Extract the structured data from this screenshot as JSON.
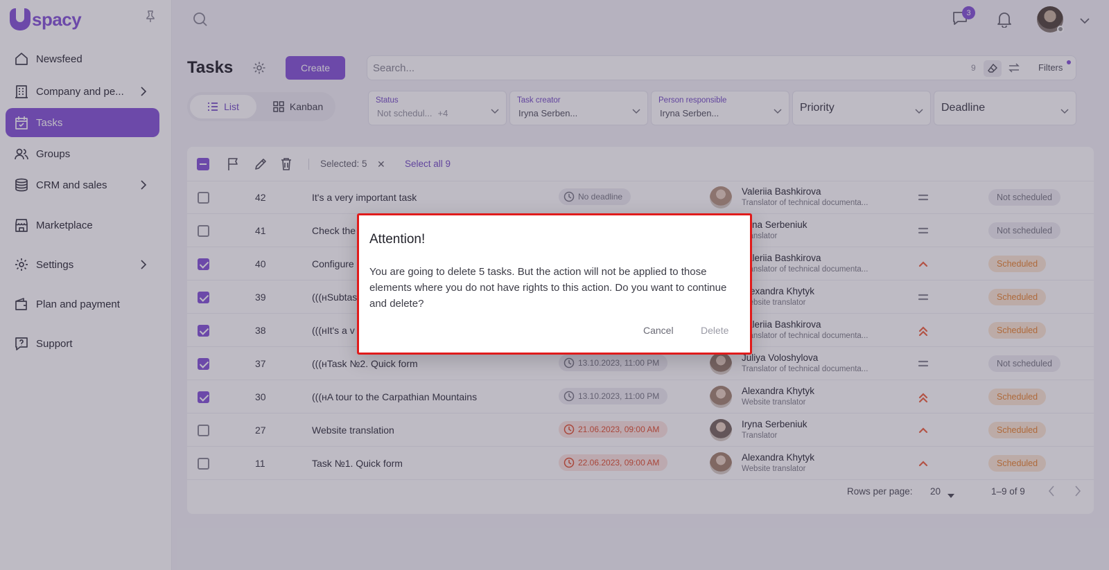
{
  "brand": {
    "name": "spacy",
    "color": "#8a5cd8"
  },
  "sidebar": {
    "items": [
      {
        "label": "Newsfeed",
        "icon": "home-icon",
        "has_children": false,
        "active": false
      },
      {
        "label": "Company and pe...",
        "icon": "building-icon",
        "has_children": true,
        "active": false
      },
      {
        "label": "Tasks",
        "icon": "calendar-check-icon",
        "has_children": false,
        "active": true
      },
      {
        "label": "Groups",
        "icon": "users-icon",
        "has_children": false,
        "active": false
      },
      {
        "label": "CRM and sales",
        "icon": "coins-icon",
        "has_children": true,
        "active": false
      },
      {
        "label": "Marketplace",
        "icon": "store-icon",
        "has_children": false,
        "active": false
      },
      {
        "label": "Settings",
        "icon": "gear-icon",
        "has_children": true,
        "active": false
      },
      {
        "label": "Plan and payment",
        "icon": "wallet-icon",
        "has_children": false,
        "active": false
      },
      {
        "label": "Support",
        "icon": "help-icon",
        "has_children": false,
        "active": false
      }
    ]
  },
  "header": {
    "messages_badge": "3"
  },
  "tasks": {
    "title": "Tasks",
    "create_label": "Create",
    "search_placeholder": "Search...",
    "search_count": "9",
    "filters_label": "Filters",
    "views": {
      "list": "List",
      "kanban": "Kanban",
      "active": "list"
    },
    "filters": [
      {
        "label": "Status",
        "value": "Not schedul...",
        "more": "+4"
      },
      {
        "label": "Task creator",
        "value": "Iryna Serben..."
      },
      {
        "label": "Person responsible",
        "value": "Iryna Serben..."
      },
      {
        "placeholder": "Priority"
      },
      {
        "placeholder": "Deadline"
      }
    ],
    "toolbar": {
      "selected_label": "Selected: 5",
      "select_all_label": "Select all 9"
    },
    "rows": [
      {
        "id": "42",
        "name": "It's a very important task",
        "deadline": "No deadline",
        "deadline_state": "none",
        "person": "Valeriia Bashkirova",
        "role": "Translator of technical documenta...",
        "priority": "medium",
        "status": "Not scheduled",
        "checked": false
      },
      {
        "id": "41",
        "name": "Check the",
        "deadline": "",
        "deadline_state": "none",
        "person": "Iryna Serbeniuk",
        "role": "Translator",
        "priority": "medium",
        "status": "Not scheduled",
        "checked": false
      },
      {
        "id": "40",
        "name": "Configure",
        "deadline": "",
        "deadline_state": "none",
        "person": "Valeriia Bashkirova",
        "role": "Translator of technical documenta...",
        "priority": "high",
        "status": "Scheduled",
        "checked": true
      },
      {
        "id": "39",
        "name": "(((нSubtas",
        "deadline": "",
        "deadline_state": "none",
        "person": "Alexandra Khytyk",
        "role": "Website translator",
        "priority": "medium",
        "status": "Scheduled",
        "checked": true
      },
      {
        "id": "38",
        "name": "(((нIt's a v",
        "deadline": "",
        "deadline_state": "none",
        "person": "Valeriia Bashkirova",
        "role": "Translator of technical documenta...",
        "priority": "highest",
        "status": "Scheduled",
        "checked": true
      },
      {
        "id": "37",
        "name": "(((нTask №2. Quick form",
        "deadline": "13.10.2023, 11:00 PM",
        "deadline_state": "future",
        "person": "Juliya Voloshylova",
        "role": "Translator of technical documenta...",
        "priority": "medium",
        "status": "Not scheduled",
        "checked": true
      },
      {
        "id": "30",
        "name": "(((нA tour to the Carpathian Mountains",
        "deadline": "13.10.2023, 11:00 PM",
        "deadline_state": "future",
        "person": "Alexandra Khytyk",
        "role": "Website translator",
        "priority": "highest",
        "status": "Scheduled",
        "checked": true
      },
      {
        "id": "27",
        "name": "Website translation",
        "deadline": "21.06.2023, 09:00 AM",
        "deadline_state": "overdue",
        "person": "Iryna Serbeniuk",
        "role": "Translator",
        "priority": "high",
        "status": "Scheduled",
        "checked": false
      },
      {
        "id": "11",
        "name": "Task №1. Quick form",
        "deadline": "22.06.2023, 09:00 AM",
        "deadline_state": "overdue",
        "person": "Alexandra Khytyk",
        "role": "Website translator",
        "priority": "high",
        "status": "Scheduled",
        "checked": false
      }
    ],
    "pagination": {
      "rows_per_page_label": "Rows per page:",
      "rows_per_page": "20",
      "range": "1–9 of 9"
    }
  },
  "dialog": {
    "title": "Attention!",
    "message": "You are going to delete 5 tasks. But the action will not be applied to those elements where you do not have rights to this action. Do you want to continue and delete?",
    "cancel_label": "Cancel",
    "delete_label": "Delete"
  }
}
